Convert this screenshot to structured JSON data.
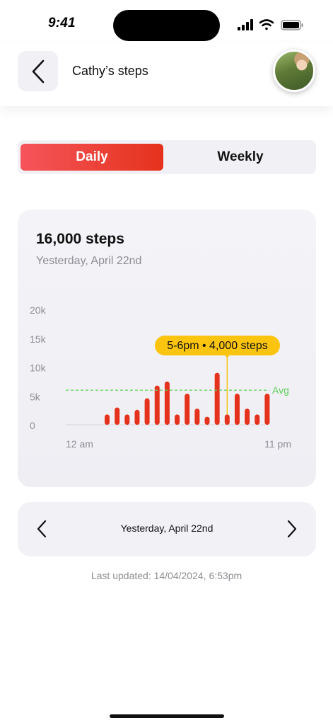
{
  "status_bar": {
    "time": "9:41",
    "icons": [
      "signal-icon",
      "wifi-icon",
      "battery-icon"
    ]
  },
  "header": {
    "title": "Cathy’s steps",
    "back_icon": "chevron-left-icon"
  },
  "segmented": {
    "daily_label": "Daily",
    "weekly_label": "Weekly",
    "selected": "Daily",
    "accent": "#e5321c"
  },
  "card": {
    "total": "16,000 steps",
    "date": "Yesterday, April 22nd"
  },
  "chart_data": {
    "type": "bar",
    "title": "",
    "x_start_label": "12 am",
    "x_end_label": "11 pm",
    "y_tick_labels": [
      "20k",
      "15k",
      "10k",
      "5k",
      "0"
    ],
    "y_ticks": [
      20000,
      15000,
      10000,
      5000,
      0
    ],
    "ylim": [
      0,
      20000
    ],
    "hours": [
      5,
      6,
      7,
      8,
      9,
      10,
      11,
      12,
      13,
      14,
      15,
      16,
      17,
      18,
      19,
      20,
      21,
      22
    ],
    "values": [
      1800,
      3000,
      1800,
      2600,
      4600,
      6800,
      7500,
      1800,
      5400,
      2800,
      1400,
      9000,
      1800,
      5400,
      2800,
      1800,
      5400,
      0
    ],
    "average": 6000,
    "average_label": "Avg",
    "tooltip": "5-6pm • 4,000 steps",
    "highlight_hour": 17,
    "bar_color": "#e5321c",
    "avg_color": "#5fcf5a",
    "tooltip_color": "#fbc40f",
    "grid": false
  },
  "date_nav": {
    "label": "Yesterday, April 22nd",
    "prev_icon": "chevron-left-icon",
    "next_icon": "chevron-right-icon"
  },
  "footer": {
    "last_updated": "Last updated: 14/04/2024, 6:53pm"
  }
}
